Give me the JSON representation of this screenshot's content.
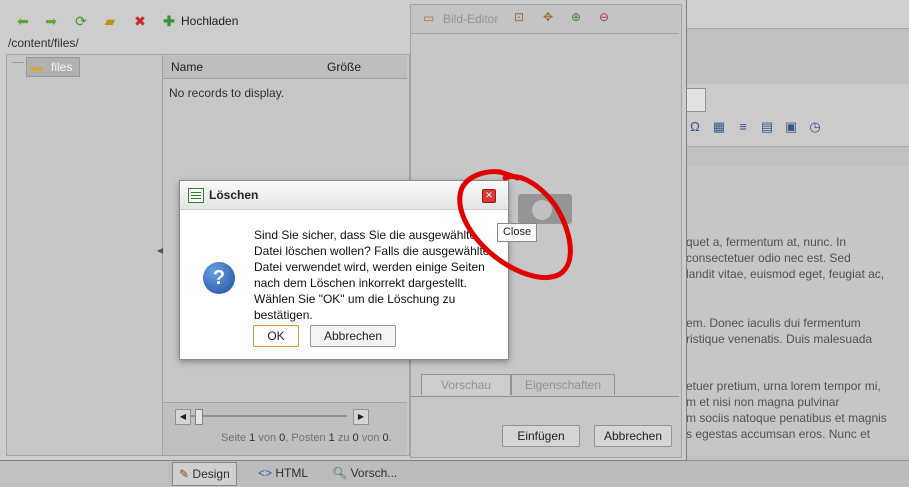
{
  "toolbar": {
    "upload_label": "Hochladen",
    "icons": [
      "back-arrow-icon",
      "forward-arrow-icon",
      "refresh-icon",
      "new-folder-icon",
      "delete-icon",
      "plus-icon"
    ]
  },
  "path": "/content/files/",
  "tree": {
    "folder_label": "files"
  },
  "file_list": {
    "columns": [
      "Name",
      "Größe"
    ],
    "empty_text": "No records to display.",
    "pager_text_parts": [
      "Seite ",
      "1",
      " von ",
      "0",
      ", Posten ",
      "1",
      " zu ",
      "0",
      " von ",
      "0",
      "."
    ]
  },
  "image_editor": {
    "label": "Bild-Editor",
    "tabs": [
      "Vorschau",
      "Eigenschaften"
    ],
    "insert_label": "Einfügen",
    "cancel_label": "Abbrechen"
  },
  "dialog": {
    "title": "Löschen",
    "message": "Sind Sie sicher, dass Sie die ausgewählte Datei löschen wollen? Falls die ausgewählte Datei verwendet wird, werden einige Seiten nach dem Löschen inkorrekt dargestellt. Wählen Sie \"OK\" um die Löschung zu bestätigen.",
    "message_lines": [
      "Sind Sie sicher, dass Sie die ausgewählte",
      "Datei löschen wollen? Falls die ausgewählte",
      "Datei verwendet wird, werden einige Seiten",
      "nach dem Löschen inkorrekt dargestellt.",
      "Wählen Sie \"OK\" um die Löschung zu",
      "bestätigen."
    ],
    "ok_label": "OK",
    "cancel_label": "Abbrechen",
    "close_tooltip": "Close"
  },
  "background_editor": {
    "paragraphs": [
      [
        "quet a, fermentum at, nunc. In",
        "consectetuer odio nec est. Sed",
        "landit vitae, euismod eget, feugiat ac,"
      ],
      [
        "em. Donec iaculis dui fermentum",
        "ristique venenatis. Duis malesuada"
      ],
      [
        "etuer pretium, urna lorem tempor mi,",
        "m et nisi non magna pulvinar",
        "m sociis natoque penatibus et magnis",
        "s egestas accumsan eros. Nunc et"
      ]
    ],
    "tabs": [
      "Design",
      "HTML",
      "Vorsch..."
    ]
  },
  "colors": {
    "annotation": "#e00000",
    "close_button": "#d83a3a",
    "help_icon": "#2f5fb0"
  }
}
